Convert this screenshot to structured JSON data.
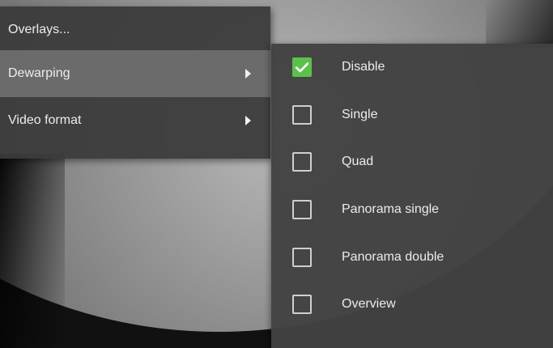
{
  "main_menu": {
    "items": [
      {
        "label": "Overlays...",
        "has_submenu": false,
        "active": false
      },
      {
        "label": "Dewarping",
        "has_submenu": true,
        "active": true
      },
      {
        "label": "Video format",
        "has_submenu": true,
        "active": false
      }
    ]
  },
  "dewarping_submenu": {
    "options": [
      {
        "label": "Disable",
        "checked": true
      },
      {
        "label": "Single",
        "checked": false
      },
      {
        "label": "Quad",
        "checked": false
      },
      {
        "label": "Panorama single",
        "checked": false
      },
      {
        "label": "Panorama double",
        "checked": false
      },
      {
        "label": "Overview",
        "checked": false
      }
    ]
  },
  "icons": {
    "submenu_arrow": "chevron-right-icon",
    "checked": "checkmark-icon"
  },
  "colors": {
    "checked_accent": "#5cc14c",
    "active_item_bg": "#6b6b6b",
    "menu_bg": "#3a3a3a"
  }
}
